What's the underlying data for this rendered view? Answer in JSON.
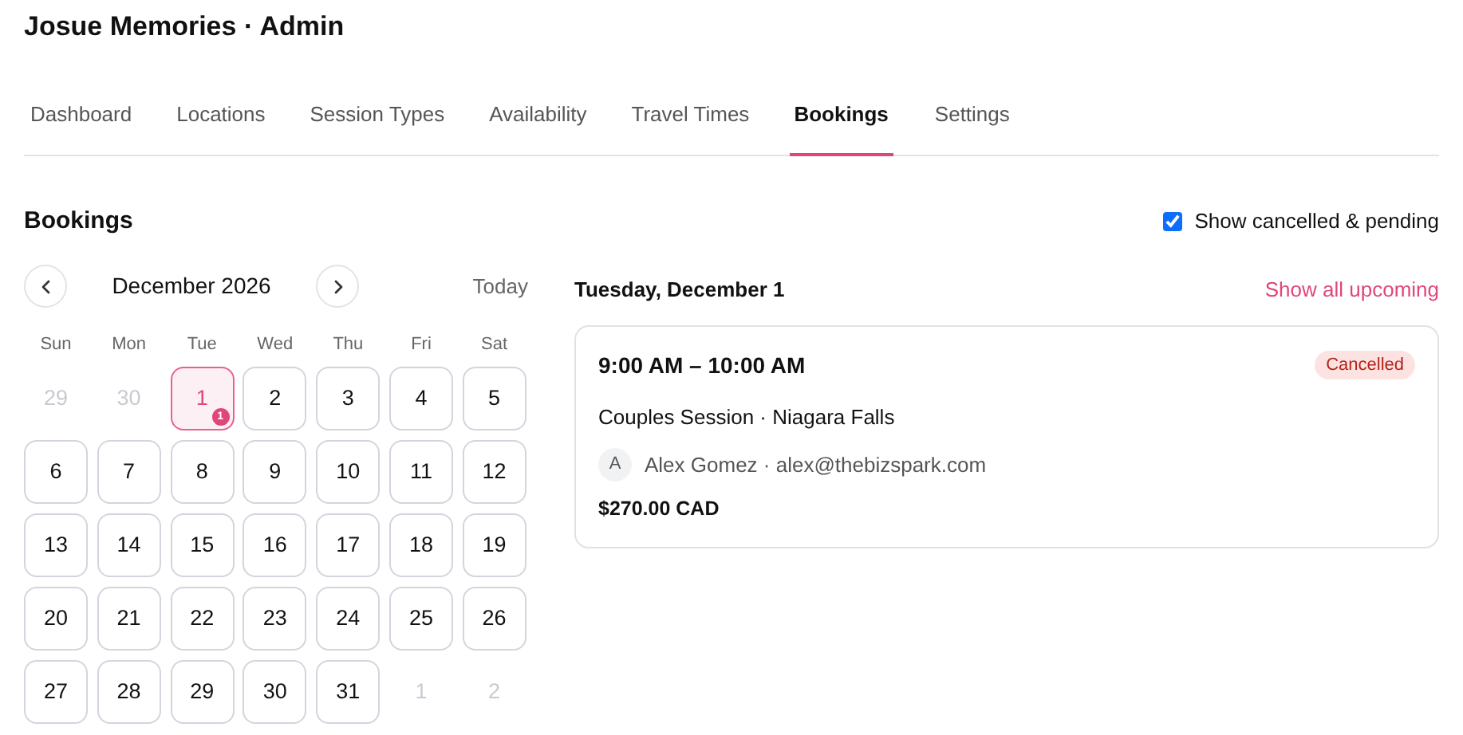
{
  "app_title": "Josue Memories · Admin",
  "tabs": [
    {
      "label": "Dashboard",
      "selected": false
    },
    {
      "label": "Locations",
      "selected": false
    },
    {
      "label": "Session Types",
      "selected": false
    },
    {
      "label": "Availability",
      "selected": false
    },
    {
      "label": "Travel Times",
      "selected": false
    },
    {
      "label": "Bookings",
      "selected": true
    },
    {
      "label": "Settings",
      "selected": false
    }
  ],
  "section_title": "Bookings",
  "filter": {
    "label": "Show cancelled & pending",
    "checked": true
  },
  "calendar": {
    "month": "December 2026",
    "today_label": "Today",
    "weekdays": [
      "Sun",
      "Mon",
      "Tue",
      "Wed",
      "Thu",
      "Fri",
      "Sat"
    ],
    "days": [
      {
        "label": "29",
        "kind": "outside",
        "selected": false
      },
      {
        "label": "30",
        "kind": "outside",
        "selected": false
      },
      {
        "label": "1",
        "kind": "day",
        "selected": true,
        "count": "1"
      },
      {
        "label": "2",
        "kind": "day",
        "selected": false
      },
      {
        "label": "3",
        "kind": "day",
        "selected": false
      },
      {
        "label": "4",
        "kind": "day",
        "selected": false
      },
      {
        "label": "5",
        "kind": "day",
        "selected": false
      },
      {
        "label": "6",
        "kind": "day",
        "selected": false
      },
      {
        "label": "7",
        "kind": "day",
        "selected": false
      },
      {
        "label": "8",
        "kind": "day",
        "selected": false
      },
      {
        "label": "9",
        "kind": "day",
        "selected": false
      },
      {
        "label": "10",
        "kind": "day",
        "selected": false
      },
      {
        "label": "11",
        "kind": "day",
        "selected": false
      },
      {
        "label": "12",
        "kind": "day",
        "selected": false
      },
      {
        "label": "13",
        "kind": "day",
        "selected": false
      },
      {
        "label": "14",
        "kind": "day",
        "selected": false
      },
      {
        "label": "15",
        "kind": "day",
        "selected": false
      },
      {
        "label": "16",
        "kind": "day",
        "selected": false
      },
      {
        "label": "17",
        "kind": "day",
        "selected": false
      },
      {
        "label": "18",
        "kind": "day",
        "selected": false
      },
      {
        "label": "19",
        "kind": "day",
        "selected": false
      },
      {
        "label": "20",
        "kind": "day",
        "selected": false
      },
      {
        "label": "21",
        "kind": "day",
        "selected": false
      },
      {
        "label": "22",
        "kind": "day",
        "selected": false
      },
      {
        "label": "23",
        "kind": "day",
        "selected": false
      },
      {
        "label": "24",
        "kind": "day",
        "selected": false
      },
      {
        "label": "25",
        "kind": "day",
        "selected": false
      },
      {
        "label": "26",
        "kind": "day",
        "selected": false
      },
      {
        "label": "27",
        "kind": "day",
        "selected": false
      },
      {
        "label": "28",
        "kind": "day",
        "selected": false
      },
      {
        "label": "29",
        "kind": "day",
        "selected": false
      },
      {
        "label": "30",
        "kind": "day",
        "selected": false
      },
      {
        "label": "31",
        "kind": "day",
        "selected": false
      },
      {
        "label": "1",
        "kind": "outside",
        "selected": false
      },
      {
        "label": "2",
        "kind": "outside",
        "selected": false
      }
    ]
  },
  "day_panel": {
    "date": "Tuesday, December 1",
    "link": "Show all upcoming",
    "bookings": [
      {
        "time": "9:00 AM – 10:00 AM",
        "status": "Cancelled",
        "service": "Couples Session · Niagara Falls",
        "avatar": "A",
        "client": "Alex Gomez · alex@thebizspark.com",
        "price": "$270.00 CAD"
      }
    ]
  }
}
